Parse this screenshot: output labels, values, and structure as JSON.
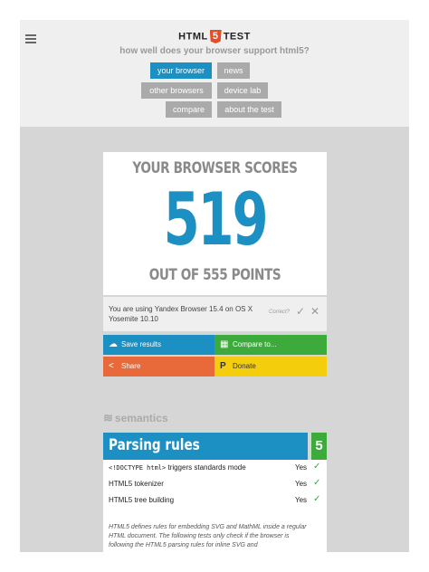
{
  "header": {
    "logo_left": "HTML",
    "logo_five": "5",
    "logo_right": "TEST",
    "tagline": "how well does your browser support html5?"
  },
  "nav": {
    "your_browser": "your browser",
    "news": "news",
    "other_browsers": "other browsers",
    "device_lab": "device lab",
    "compare": "compare",
    "about": "about the test"
  },
  "score": {
    "heading": "YOUR BROWSER SCORES",
    "value": "519",
    "footer": "OUT OF 555 POINTS"
  },
  "ua": {
    "text": "You are using Yandex Browser 15.4 on OS X Yosemite 10.10",
    "correct_prompt": "Correct?"
  },
  "actions": {
    "save": "Save results",
    "compare": "Compare to...",
    "share": "Share",
    "donate": "Donate"
  },
  "colors": {
    "blue": "#1c8fc3",
    "green": "#3cab3b",
    "orange": "#e8693a",
    "yellow": "#f4cd0c"
  },
  "section": {
    "name": "semantics",
    "category_title": "Parsing rules",
    "category_score": "5"
  },
  "tests": [
    {
      "code": "<!DOCTYPE html>",
      "name": " triggers standards mode",
      "result": "Yes"
    },
    {
      "code": "",
      "name": "HTML5 tokenizer",
      "result": "Yes"
    },
    {
      "code": "",
      "name": "HTML5 tree building",
      "result": "Yes"
    }
  ],
  "tests_description": "HTML5 defines rules for embedding SVG and MathML inside a regular HTML document. The following tests only check if the browser is following the HTML5 parsing rules for inline SVG and"
}
